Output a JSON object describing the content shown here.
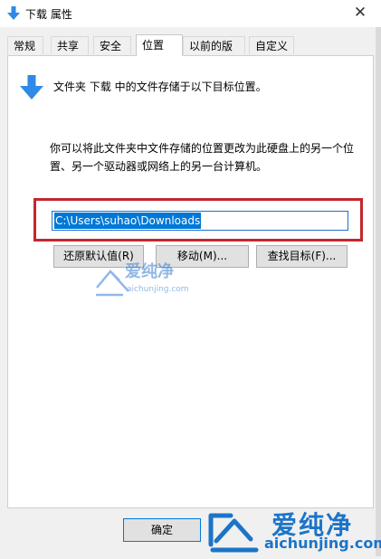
{
  "window": {
    "title": "下载 属性",
    "close_symbol": "✕"
  },
  "tabs": [
    {
      "label": "常规",
      "active": false
    },
    {
      "label": "共享",
      "active": false
    },
    {
      "label": "安全",
      "active": false
    },
    {
      "label": "位置",
      "active": true
    },
    {
      "label": "以前的版本",
      "active": false
    },
    {
      "label": "自定义",
      "active": false
    }
  ],
  "location": {
    "info_text": "文件夹 下载 中的文件存储于以下目标位置。",
    "description": "你可以将此文件夹中文件存储的位置更改为此硬盘上的另一个位置、另一个驱动器或网络上的另一台计算机。",
    "path_value": "C:\\Users\\suhao\\Downloads",
    "restore_label": "还原默认值(R)",
    "move_label": "移动(M)...",
    "find_label": "查找目标(F)..."
  },
  "footer": {
    "ok_label": "确定"
  },
  "watermark": {
    "small_text": "爱纯净",
    "small_url": "aichunjing.com",
    "big_text": "爱纯净",
    "big_url": "aichunjing.com"
  },
  "colors": {
    "accent": "#0078d7",
    "highlight": "#c4262e",
    "watermark": "#1c74c8"
  }
}
